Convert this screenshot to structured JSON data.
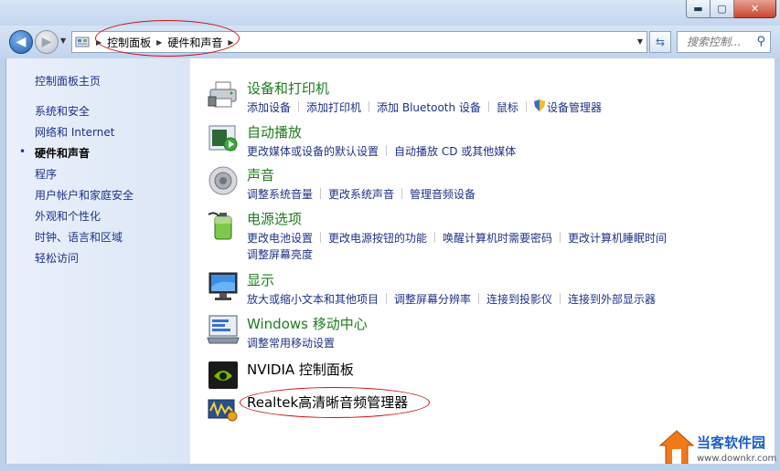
{
  "window": {
    "min_glyph": "▬",
    "max_glyph": "▢",
    "close_glyph": "✕"
  },
  "nav": {
    "back_glyph": "◀",
    "forward_glyph": "▶",
    "breadcrumb": [
      "控制面板",
      "硬件和声音"
    ],
    "search_placeholder": "搜索控制..."
  },
  "sidebar": {
    "items": [
      {
        "label": "控制面板主页",
        "current": false
      },
      {
        "label": "系统和安全",
        "current": false
      },
      {
        "label": "网络和 Internet",
        "current": false
      },
      {
        "label": "硬件和声音",
        "current": true
      },
      {
        "label": "程序",
        "current": false
      },
      {
        "label": "用户帐户和家庭安全",
        "current": false
      },
      {
        "label": "外观和个性化",
        "current": false
      },
      {
        "label": "时钟、语言和区域",
        "current": false
      },
      {
        "label": "轻松访问",
        "current": false
      }
    ],
    "bullet": "•"
  },
  "categories": [
    {
      "title": "设备和打印机",
      "icon": "printer-icon",
      "rows": [
        [
          "添加设备",
          "添加打印机",
          "添加 Bluetooth 设备",
          "鼠标",
          "设备管理器"
        ]
      ]
    },
    {
      "title": "自动播放",
      "icon": "autoplay-icon",
      "rows": [
        [
          "更改媒体或设备的默认设置",
          "自动播放 CD 或其他媒体"
        ]
      ]
    },
    {
      "title": "声音",
      "icon": "speaker-icon",
      "rows": [
        [
          "调整系统音量",
          "更改系统声音",
          "管理音频设备"
        ]
      ]
    },
    {
      "title": "电源选项",
      "icon": "battery-icon",
      "rows": [
        [
          "更改电池设置",
          "更改电源按钮的功能",
          "唤醒计算机时需要密码",
          "更改计算机睡眠时间"
        ],
        [
          "调整屏幕亮度"
        ]
      ]
    },
    {
      "title": "显示",
      "icon": "monitor-icon",
      "rows": [
        [
          "放大或缩小文本和其他项目",
          "调整屏幕分辨率",
          "连接到投影仪",
          "连接到外部显示器"
        ]
      ]
    },
    {
      "title": "Windows 移动中心",
      "icon": "mobility-center-icon",
      "rows": [
        [
          "调整常用移动设置"
        ]
      ]
    },
    {
      "title": "NVIDIA 控制面板",
      "icon": "nvidia-icon",
      "rows": []
    },
    {
      "title": "Realtek高清晰音频管理器",
      "icon": "realtek-audio-icon",
      "rows": []
    }
  ],
  "watermark": {
    "name": "当客软件园",
    "url": "www.downkr.com"
  },
  "colors": {
    "link": "#1e3287",
    "category_title": "#1e7b1e",
    "annotation": "#cc1111"
  }
}
